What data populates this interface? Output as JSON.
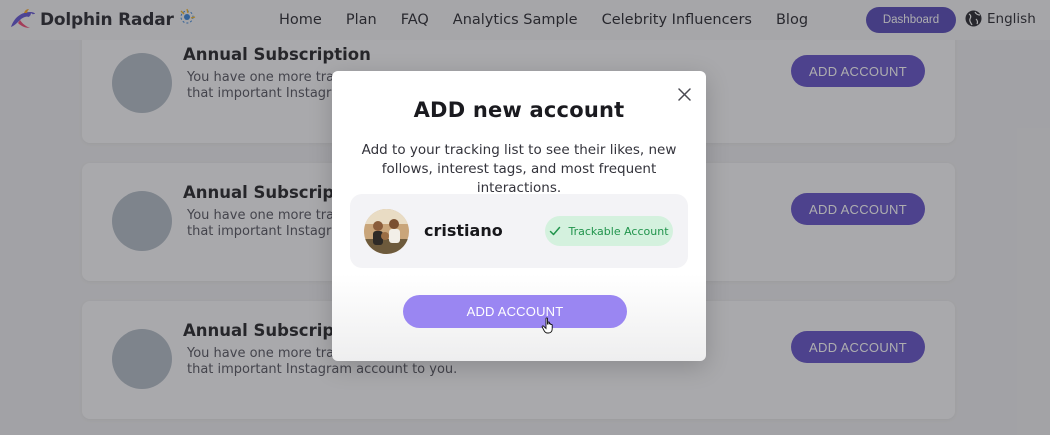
{
  "brand": {
    "name": "Dolphin Radar"
  },
  "nav": {
    "items": [
      {
        "label": "Home"
      },
      {
        "label": "Plan"
      },
      {
        "label": "FAQ"
      },
      {
        "label": "Analytics Sample"
      },
      {
        "label": "Celebrity Influencers"
      },
      {
        "label": "Blog"
      }
    ],
    "dashboard_label": "Dashboard",
    "language_label": "English"
  },
  "cards": [
    {
      "title": "Annual Subscription",
      "description": "You have one more tracking slot available. Add that important Instagram account to you.",
      "button_label": "ADD ACCOUNT"
    },
    {
      "title": "Annual Subscription",
      "description": "You have one more tracking slot available. Add that important Instagram account to you.",
      "button_label": "ADD ACCOUNT"
    },
    {
      "title": "Annual Subscription",
      "description": "You have one more tracking slot available. Add that important Instagram account to you.",
      "button_label": "ADD ACCOUNT"
    }
  ],
  "modal": {
    "title": "ADD new account",
    "description": "Add to your tracking list to see their likes, new follows, interest tags, and most frequent interactions.",
    "account": {
      "username": "cristiano",
      "badge_label": "Trackable Account"
    },
    "button_label": "ADD ACCOUNT"
  },
  "colors": {
    "primary": "#5a48c4",
    "dashboard": "#4d3fb4",
    "modal_button": "#9a86f2",
    "badge_bg": "#d4f1de",
    "badge_text": "#21944c"
  },
  "icons": [
    "dolphin-logo-icon",
    "radar-icon",
    "globe-icon",
    "close-icon",
    "check-icon",
    "hand-cursor-icon"
  ]
}
